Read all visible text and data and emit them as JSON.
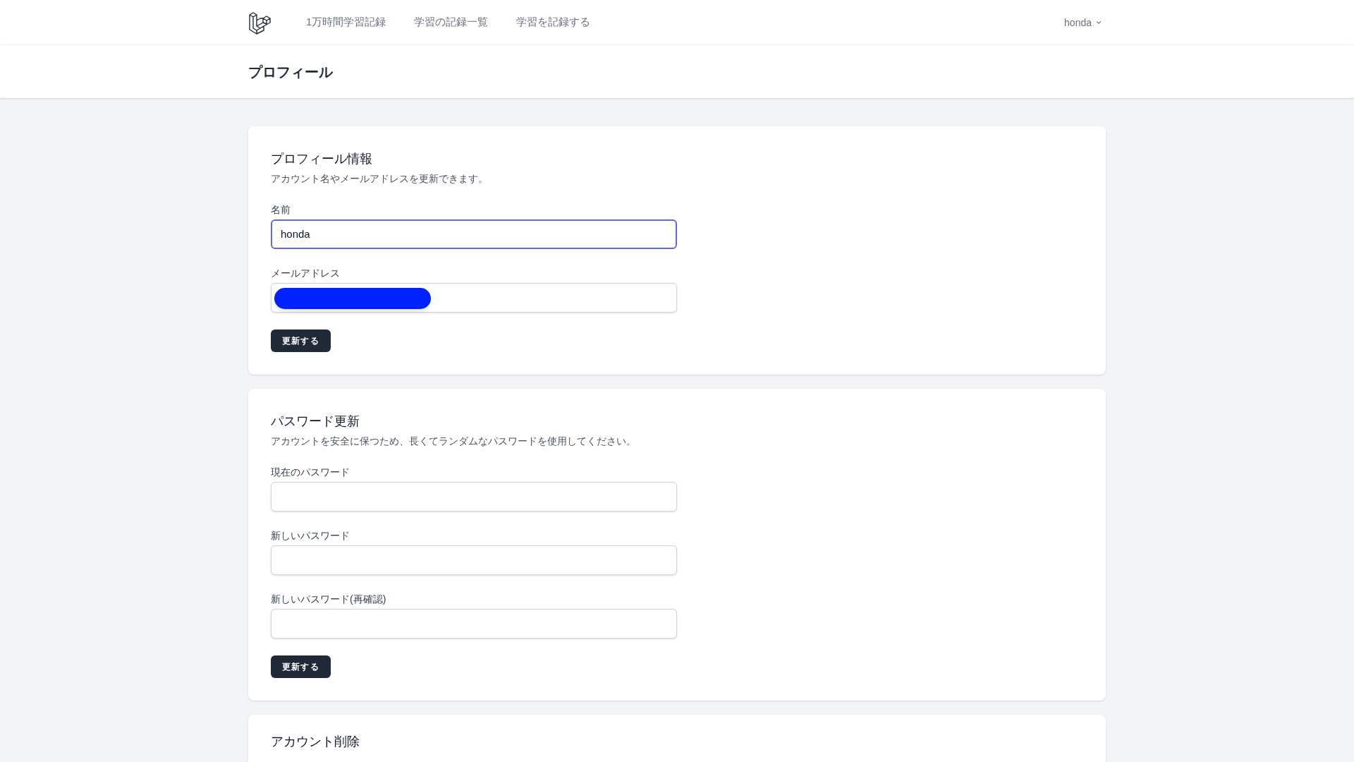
{
  "nav": {
    "links": [
      {
        "label": "1万時間学習記録"
      },
      {
        "label": "学習の記録一覧"
      },
      {
        "label": "学習を記録する"
      }
    ],
    "user": "honda"
  },
  "page_title": "プロフィール",
  "profile": {
    "title": "プロフィール情報",
    "description": "アカウント名やメールアドレスを更新できます。",
    "fields": [
      {
        "label": "名前",
        "value": "honda",
        "focused": true,
        "redacted": false
      },
      {
        "label": "メールアドレス",
        "focused": false,
        "redacted": true
      }
    ],
    "button": "更新する"
  },
  "password": {
    "title": "パスワード更新",
    "description": "アカウントを安全に保つため、長くてランダムなパスワードを使用してください。",
    "fields": [
      {
        "label": "現在のパスワード"
      },
      {
        "label": "新しいパスワード"
      },
      {
        "label": "新しいパスワード(再確認)"
      }
    ],
    "button": "更新する"
  },
  "delete": {
    "title": "アカウント削除"
  }
}
